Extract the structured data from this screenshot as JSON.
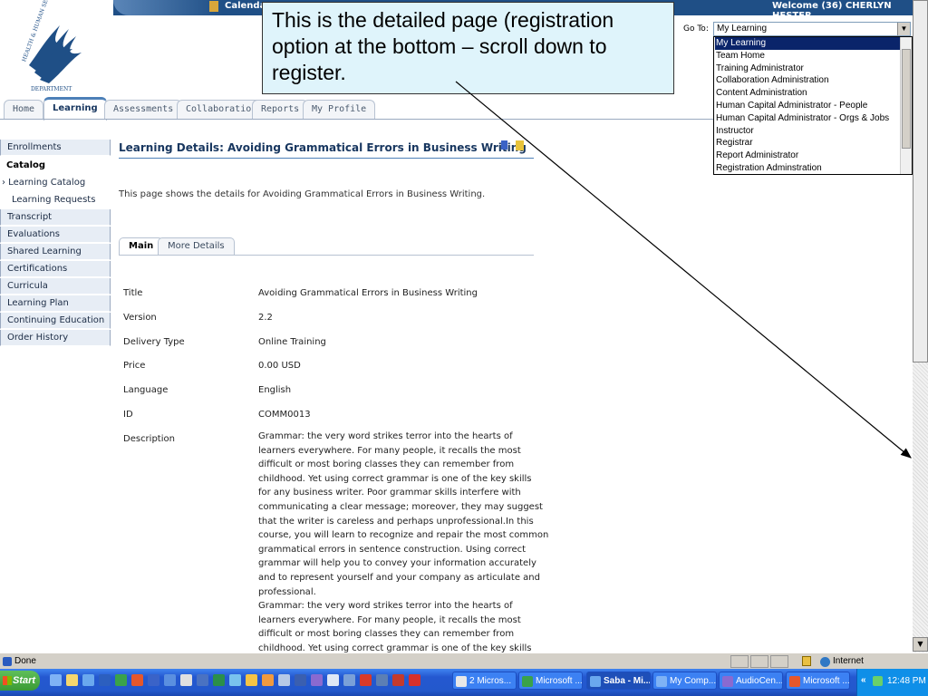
{
  "header": {
    "calendar_label": "Calendar",
    "welcome_text": "Welcome (36)  CHERLYN HESTER"
  },
  "tabs": [
    {
      "label": "Home"
    },
    {
      "label": "Learning"
    },
    {
      "label": "Assessments"
    },
    {
      "label": "Collaboration"
    },
    {
      "label": "Reports"
    },
    {
      "label": "My Profile"
    }
  ],
  "goto": {
    "label": "Go To:",
    "selected": "My Learning",
    "options": [
      "My Learning",
      "Team Home",
      "Training Administrator",
      "Collaboration Administration",
      "Content Administration",
      "Human Capital Administrator - People",
      "Human Capital Administrator - Orgs & Jobs",
      "Instructor",
      "Registrar",
      "Report Administrator",
      "Registration Adminstration"
    ]
  },
  "callout": {
    "text": "This is the detailed page (registration option at the bottom – scroll down to register."
  },
  "sidebar": {
    "items": [
      {
        "label": "Enrollments"
      },
      {
        "label": "Catalog"
      },
      {
        "label": "› Learning Catalog"
      },
      {
        "label": "Learning Requests"
      },
      {
        "label": "Transcript"
      },
      {
        "label": "Evaluations"
      },
      {
        "label": "Shared Learning"
      },
      {
        "label": "Certifications"
      },
      {
        "label": "Curricula"
      },
      {
        "label": "Learning Plan"
      },
      {
        "label": "Continuing Education"
      },
      {
        "label": "Order History"
      }
    ]
  },
  "main": {
    "title": "Learning Details: Avoiding Grammatical Errors in Business Writing",
    "intro": "This page shows the details for Avoiding Grammatical Errors in Business Writing.",
    "subtabs": [
      {
        "label": "Main"
      },
      {
        "label": "More Details"
      }
    ],
    "fields": [
      {
        "label": "Title",
        "value": "Avoiding Grammatical Errors in Business Writing"
      },
      {
        "label": "Version",
        "value": "2.2"
      },
      {
        "label": "Delivery Type",
        "value": "Online Training"
      },
      {
        "label": "Price",
        "value": "0.00 USD"
      },
      {
        "label": "Language",
        "value": "English"
      },
      {
        "label": "ID",
        "value": "COMM0013"
      },
      {
        "label": "Description",
        "value": ""
      }
    ],
    "description_lines": [
      "Grammar: the very word strikes terror into the hearts of",
      "learners everywhere. For many people, it recalls the most",
      "difficult or most boring classes they can remember from",
      "childhood. Yet using correct grammar is one of the key skills",
      "for any business writer. Poor grammar skills interfere with",
      "communicating a clear message; moreover, they may suggest",
      "that the writer is careless and perhaps unprofessional.In this",
      "course, you will learn to recognize and repair the most common",
      "grammatical errors in sentence construction. Using correct",
      "grammar will help you to convey your information accurately",
      "and to represent yourself and your company as articulate and",
      "professional.",
      "Grammar: the very word strikes terror into the hearts of",
      "learners everywhere. For many people, it recalls the most",
      "difficult or most boring classes they can remember from",
      "childhood. Yet using correct grammar is one of the key skills"
    ]
  },
  "statusbar": {
    "status": "Done",
    "zone": "Internet"
  },
  "taskbar": {
    "start_label": "Start",
    "tasks": [
      {
        "label": "2 Micros..."
      },
      {
        "label": "Microsoft ..."
      },
      {
        "label": "Saba - Mi..."
      },
      {
        "label": "My Comp..."
      },
      {
        "label": "AudioCen..."
      },
      {
        "label": "Microsoft ..."
      }
    ],
    "clock": "12:48 PM",
    "chevron": "«"
  }
}
